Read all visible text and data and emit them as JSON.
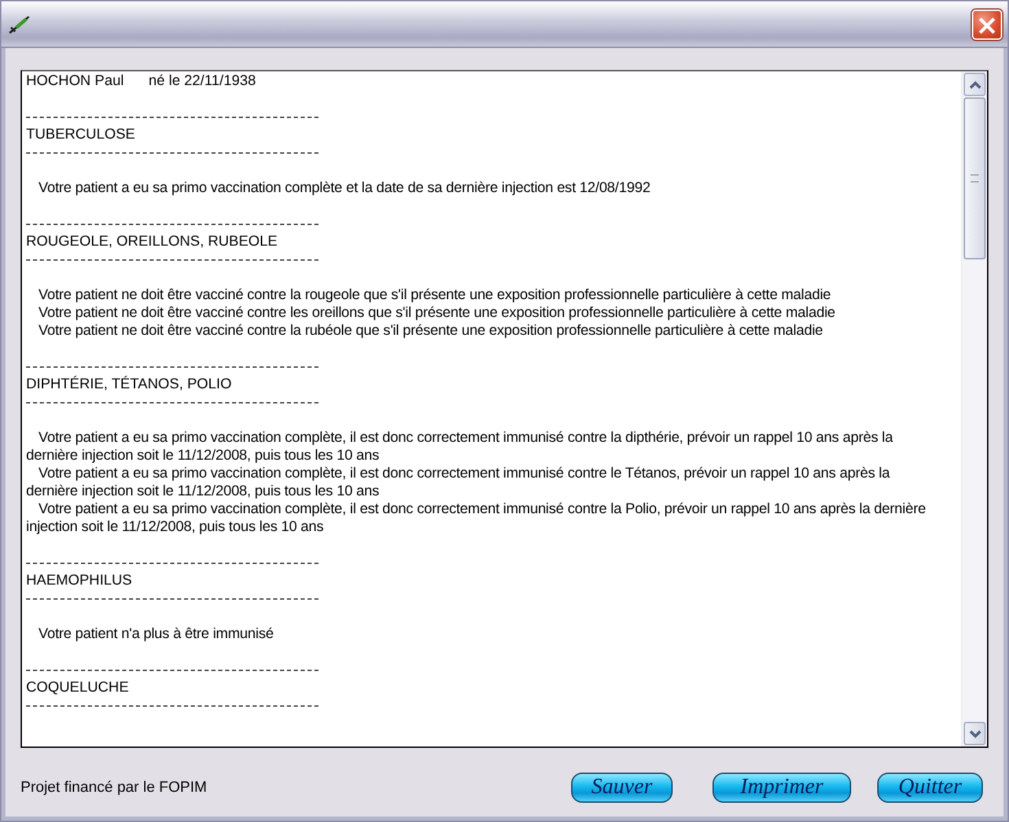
{
  "window": {
    "close": "×"
  },
  "document": {
    "blocks": [
      {
        "kind": "title",
        "name": "HOCHON Paul",
        "birth": "né le 22/11/1938"
      },
      {
        "kind": "blank"
      },
      {
        "kind": "rule"
      },
      {
        "kind": "heading",
        "text": "TUBERCULOSE"
      },
      {
        "kind": "rule"
      },
      {
        "kind": "blank"
      },
      {
        "kind": "text",
        "text": "Votre patient a eu sa primo vaccination complète et la date de sa dernière injection est 12/08/1992"
      },
      {
        "kind": "blank"
      },
      {
        "kind": "rule"
      },
      {
        "kind": "heading",
        "text": "ROUGEOLE, OREILLONS, RUBEOLE"
      },
      {
        "kind": "rule"
      },
      {
        "kind": "blank"
      },
      {
        "kind": "text",
        "text": "Votre patient ne doit être vacciné contre la rougeole que s'il présente une exposition professionnelle particulière à cette maladie"
      },
      {
        "kind": "text",
        "text": "Votre patient ne doit être vacciné contre les oreillons que s'il présente une exposition professionnelle particulière à cette maladie"
      },
      {
        "kind": "text",
        "text": "Votre patient ne doit être vacciné contre la rubéole que s'il présente une exposition professionnelle particulière à cette maladie"
      },
      {
        "kind": "blank"
      },
      {
        "kind": "rule"
      },
      {
        "kind": "heading",
        "text": "DIPHTÉRIE, TÉTANOS, POLIO"
      },
      {
        "kind": "rule"
      },
      {
        "kind": "blank"
      },
      {
        "kind": "text",
        "text": "Votre patient a eu sa primo vaccination complète, il est donc correctement immunisé contre la dipthérie, prévoir un rappel 10 ans après la\ndernière injection soit le 11/12/2008, puis tous les 10 ans"
      },
      {
        "kind": "text",
        "text": "Votre patient a eu sa primo vaccination complète, il est donc correctement immunisé contre le Tétanos, prévoir un rappel 10 ans après la\ndernière injection soit le 11/12/2008, puis tous les 10 ans"
      },
      {
        "kind": "text",
        "text": "Votre patient a eu sa primo vaccination complète, il est donc correctement immunisé contre la Polio, prévoir un rappel 10 ans après la dernière\ninjection soit le 11/12/2008, puis tous les 10 ans"
      },
      {
        "kind": "blank"
      },
      {
        "kind": "rule"
      },
      {
        "kind": "heading",
        "text": "HAEMOPHILUS"
      },
      {
        "kind": "rule"
      },
      {
        "kind": "blank"
      },
      {
        "kind": "text",
        "text": "Votre patient n'a plus à être immunisé"
      },
      {
        "kind": "blank"
      },
      {
        "kind": "rule"
      },
      {
        "kind": "heading",
        "text": "COQUELUCHE"
      },
      {
        "kind": "rule"
      }
    ]
  },
  "footer": {
    "note": "Projet financé par le FOPIM",
    "buttons": [
      "Sauver",
      "Imprimer",
      "Quitter"
    ]
  }
}
